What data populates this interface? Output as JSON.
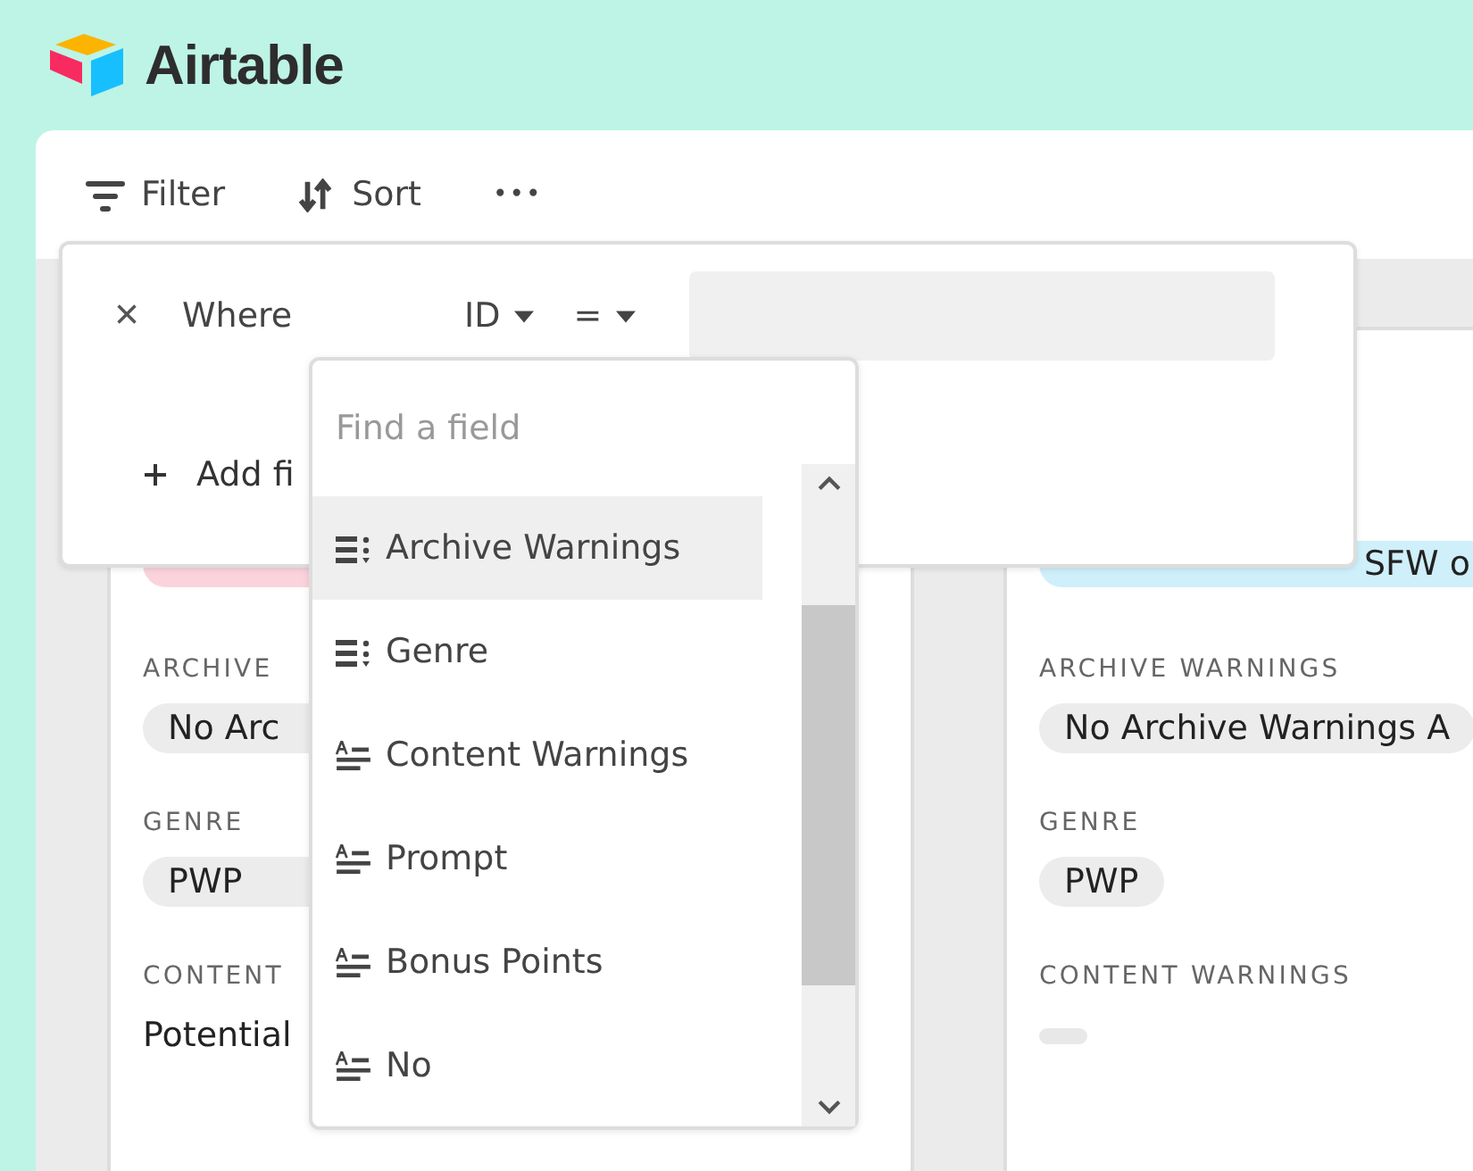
{
  "app": {
    "name": "Airtable"
  },
  "toolbar": [
    {
      "kind": "filter",
      "label": "Filter"
    },
    {
      "kind": "sort",
      "label": "Sort"
    },
    {
      "kind": "more",
      "label": "•••"
    }
  ],
  "cards": [
    {
      "tag": {
        "color": "#fbd3dc"
      },
      "fields": [
        {
          "label": "ARCHIVE",
          "chips": [
            "No Arc"
          ]
        },
        {
          "label": "GENRE",
          "chips": [
            "PWP"
          ]
        },
        {
          "label": "CONTENT",
          "text": "Potential"
        }
      ]
    },
    {
      "tag": {
        "text": "SFW o",
        "color": "#cfeffa"
      },
      "fields": [
        {
          "label": "ARCHIVE WARNINGS",
          "chips": [
            "No Archive Warnings A"
          ]
        },
        {
          "label": "GENRE",
          "chips": [
            "PWP"
          ]
        },
        {
          "label": "CONTENT WARNINGS",
          "empty": true
        }
      ]
    }
  ],
  "filter": {
    "remove": "×",
    "where": "Where",
    "field": "ID",
    "operator": "=",
    "add": "Add fi"
  },
  "field_picker": {
    "placeholder": "Find a field",
    "items": [
      {
        "label": "Archive Warnings",
        "kind": "multi",
        "selected": true
      },
      {
        "label": "Genre",
        "kind": "multi",
        "selected": false
      },
      {
        "label": "Content Warnings",
        "kind": "text",
        "selected": false
      },
      {
        "label": "Prompt",
        "kind": "text",
        "selected": false
      },
      {
        "label": "Bonus Points",
        "kind": "text",
        "selected": false
      },
      {
        "label": "No",
        "kind": "text",
        "selected": false
      }
    ]
  }
}
